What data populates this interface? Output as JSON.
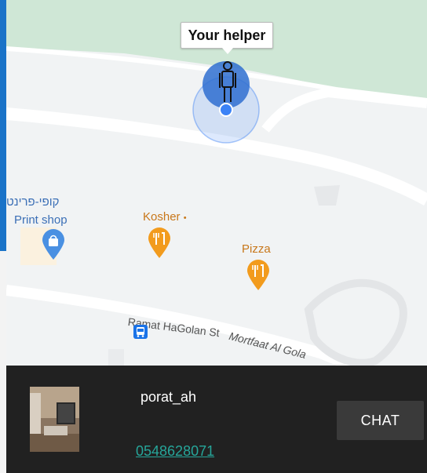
{
  "map": {
    "callout": "Your helper",
    "pois": {
      "print_shop_hebrew": "קופי-פרינט",
      "print_shop": "Print shop",
      "kosher": "Kosher",
      "kosher_dot": "•",
      "pizza": "Pizza"
    },
    "streets": {
      "ramat_hagolan": "Ramat HaGolan St",
      "mortfaat": "Mortfaat Al Gola"
    },
    "icons": [
      "person-icon",
      "shopping-bag-icon",
      "restaurant-icon",
      "bus-icon"
    ],
    "colors": {
      "park": "#cfe7d6",
      "road": "#ffffff",
      "food_pin": "#f29b1d",
      "shop_pin": "#4a90e2",
      "location": "#4285f4"
    }
  },
  "helper": {
    "username": "porat_ah",
    "phone": "0548628071",
    "chat_label": "CHAT"
  }
}
